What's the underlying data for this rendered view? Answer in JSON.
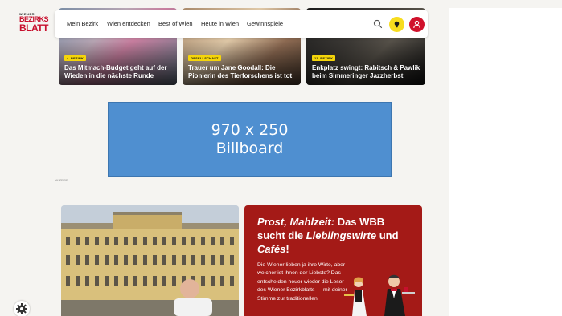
{
  "header": {
    "logo": {
      "line1": "WIENER",
      "line2": "BEZIRKS",
      "line3": "BLATT"
    },
    "nav": [
      {
        "label": "Mein Bezirk"
      },
      {
        "label": "Wien entdecken"
      },
      {
        "label": "Best of Wien"
      },
      {
        "label": "Heute in Wien"
      },
      {
        "label": "Gewinnspiele"
      }
    ],
    "icons": {
      "search": "search-icon",
      "tip": "lightbulb-icon",
      "user": "user-icon"
    }
  },
  "cards": [
    {
      "tag": "4. Bezirk",
      "title": "Das Mitmach-Budget geht auf der Wieden in die nächste Runde"
    },
    {
      "tag": "Gesellschaft",
      "title": "Trauer um Jane Goodall: Die Pionierin des Tierforschens ist tot"
    },
    {
      "tag": "11. Bezirk",
      "title": "Enkplatz swingt: Rabitsch & Pawlik beim Simmeringer Jazzherbst"
    }
  ],
  "billboard": {
    "size": "970 x 250",
    "label": "Billboard"
  },
  "ad_label": "ANZEIGE",
  "promo": {
    "title_part1": "Prost, Mahlzeit:",
    "title_part2": " Das WBB sucht die ",
    "title_part3": "Lieblingswirte",
    "title_part4": " und ",
    "title_part5": "Cafés",
    "title_part6": "!",
    "text": "Die Wiener lieben ja ihre Wirte, aber welcher ist ihnen der Liebste? Das entscheiden heuer wieder die Leser des Wiener Bezirkblatts — mit deiner Stimme zur traditionellen"
  },
  "colors": {
    "brand_red": "#c8102e",
    "tag_yellow": "#f5d50a",
    "billboard_blue": "#4f8fd0",
    "promo_red": "#a41a17"
  }
}
